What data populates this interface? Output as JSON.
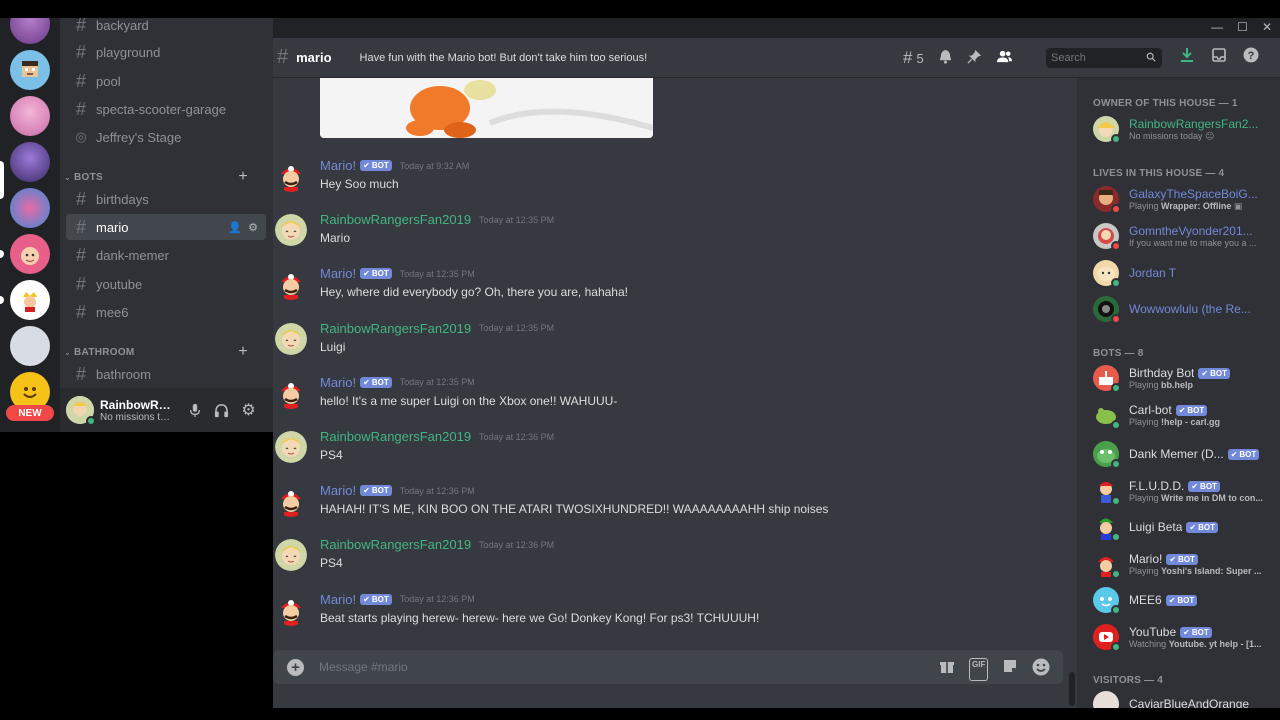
{
  "servers": {
    "new_badge": "NEW"
  },
  "channels": {
    "top": [
      {
        "name": "backyard",
        "type": "text"
      },
      {
        "name": "playground",
        "type": "text"
      },
      {
        "name": "pool",
        "type": "text"
      },
      {
        "name": "specta-scooter-garage",
        "type": "text"
      },
      {
        "name": "Jeffrey's Stage",
        "type": "stage"
      }
    ],
    "bots_category": "BOTS",
    "bots": [
      {
        "name": "birthdays"
      },
      {
        "name": "mario",
        "active": true
      },
      {
        "name": "dank-memer"
      },
      {
        "name": "youtube"
      },
      {
        "name": "mee6"
      }
    ],
    "bathroom_category": "BATHROOM",
    "bathroom": [
      {
        "name": "bathroom"
      }
    ]
  },
  "user_panel": {
    "name": "RainbowRa...",
    "status": "No missions to..."
  },
  "header": {
    "channel": "mario",
    "topic": "Have fun with the Mario bot! But don't take him too serious!",
    "thread_count": "5",
    "search_placeholder": "Search"
  },
  "bot_badge": "BOT",
  "messages": [
    {
      "author": "Mario!",
      "bot": true,
      "time": "Today at 9:32 AM",
      "text": "Hey Soo much"
    },
    {
      "author": "RainbowRangersFan2019",
      "bot": false,
      "time": "Today at 12:35 PM",
      "text": "Mario"
    },
    {
      "author": "Mario!",
      "bot": true,
      "time": "Today at 12:35 PM",
      "text": "Hey, where did everybody go? Oh, there you are, hahaha!"
    },
    {
      "author": "RainbowRangersFan2019",
      "bot": false,
      "time": "Today at 12:35 PM",
      "text": "Luigi"
    },
    {
      "author": "Mario!",
      "bot": true,
      "time": "Today at 12:35 PM",
      "text": "hello! It's a me super Luigi on the Xbox one!! WAHUUU-"
    },
    {
      "author": "RainbowRangersFan2019",
      "bot": false,
      "time": "Today at 12:36 PM",
      "text": "PS4"
    },
    {
      "author": "Mario!",
      "bot": true,
      "time": "Today at 12:36 PM",
      "text": "HAHAH! IT'S ME, KIN BOO ON THE ATARI TWOSIXHUNDRED!! WAAAAAAAAHH ship noises"
    },
    {
      "author": "RainbowRangersFan2019",
      "bot": false,
      "time": "Today at 12:36 PM",
      "text": "PS4"
    },
    {
      "author": "Mario!",
      "bot": true,
      "time": "Today at 12:36 PM",
      "text": "Beat starts playing herew- herew- here we Go! Donkey Kong! For ps3! TCHUUUH!"
    }
  ],
  "composer": {
    "placeholder": "Message #mario",
    "gif_label": "GIF"
  },
  "members": {
    "owner_heading": "OWNER OF THIS HOUSE — 1",
    "owner": [
      {
        "name": "RainbowRangersFan2...",
        "status": "No missions today 😐",
        "color": "#43b581",
        "presence": "online"
      }
    ],
    "lives_heading": "LIVES IN THIS HOUSE — 4",
    "lives": [
      {
        "name": "GalaxyTheSpaceBoiG...",
        "status_prefix": "Playing ",
        "status_bold": "Wrapper: Offline",
        "status_suffix": " ▣",
        "color": "#7289da",
        "presence": "dnd"
      },
      {
        "name": "GomntheVyonder201...",
        "status_prefix": "If you want me to make you a ...",
        "status_bold": "",
        "status_suffix": "",
        "color": "#7289da",
        "presence": "dnd"
      },
      {
        "name": "Jordan T",
        "status_prefix": "",
        "status_bold": "",
        "status_suffix": "",
        "color": "#7289da",
        "presence": "online"
      },
      {
        "name": "Wowwowlulu (the Re...",
        "status_prefix": "",
        "status_bold": "",
        "status_suffix": "",
        "color": "#7289da",
        "presence": "dnd"
      }
    ],
    "bots_heading": "BOTS — 8",
    "bots": [
      {
        "name": "Birthday Bot",
        "status_prefix": "Playing ",
        "status_bold": "bb.help"
      },
      {
        "name": "Carl-bot",
        "status_prefix": "Playing ",
        "status_bold": "!help - carl.gg"
      },
      {
        "name": "Dank Memer (D...",
        "status_prefix": "",
        "status_bold": ""
      },
      {
        "name": "F.L.U.D.D.",
        "status_prefix": "Playing ",
        "status_bold": "Write me in DM to con..."
      },
      {
        "name": "Luigi Beta",
        "status_prefix": "",
        "status_bold": ""
      },
      {
        "name": "Mario!",
        "status_prefix": "Playing ",
        "status_bold": "Yoshi's Island: Super ..."
      },
      {
        "name": "MEE6",
        "status_prefix": "",
        "status_bold": ""
      },
      {
        "name": "YouTube",
        "status_prefix": "Watching ",
        "status_bold": "Youtube. yt help - [1..."
      }
    ],
    "visitors_heading": "VISITORS — 4",
    "visitor_partial": "CaviarBlueAndOrange"
  },
  "colors": {
    "bot_badge": "#7289da",
    "online": "#43b581",
    "dnd": "#f04747",
    "download": "#43b581"
  }
}
